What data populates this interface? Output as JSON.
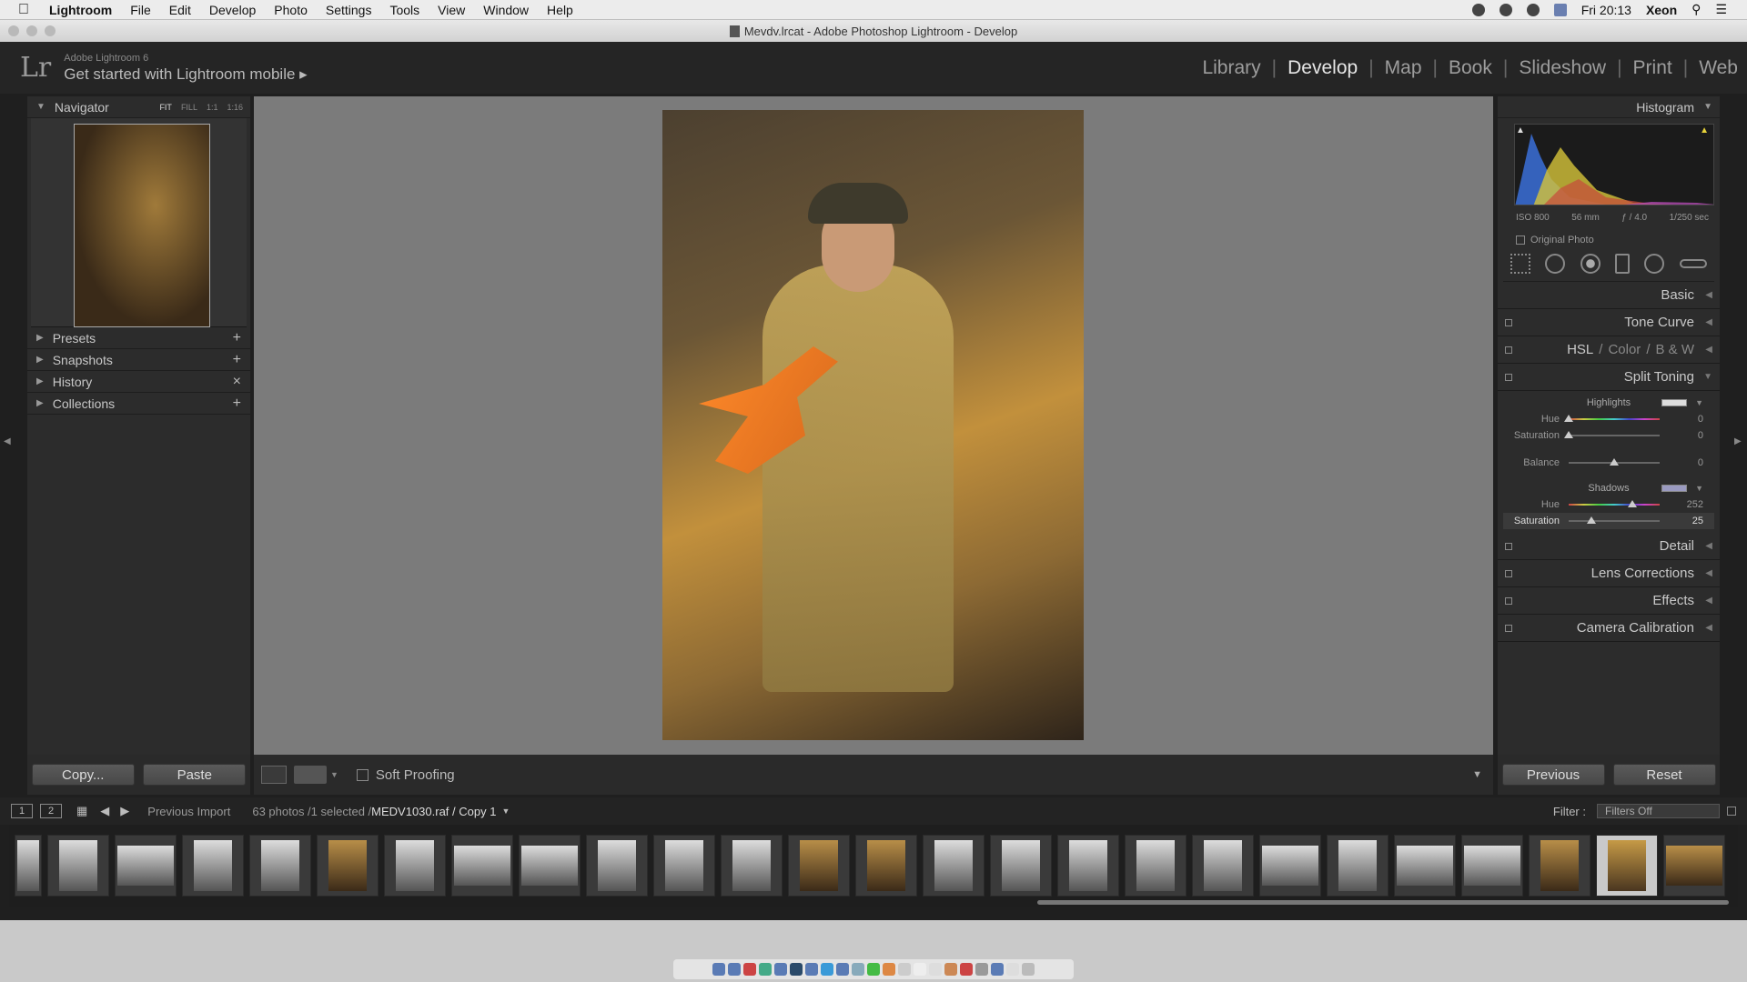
{
  "menubar": {
    "app": "Lightroom",
    "items": [
      "File",
      "Edit",
      "Develop",
      "Photo",
      "Settings",
      "Tools",
      "View",
      "Window",
      "Help"
    ],
    "clock": "Fri 20:13",
    "user": "Xeon"
  },
  "window": {
    "title": "Mevdv.lrcat - Adobe Photoshop Lightroom - Develop"
  },
  "identity": {
    "product": "Adobe Lightroom 6",
    "mobile": "Get started with Lightroom mobile"
  },
  "modules": {
    "items": [
      "Library",
      "Develop",
      "Map",
      "Book",
      "Slideshow",
      "Print",
      "Web"
    ],
    "active": "Develop"
  },
  "left_panel": {
    "navigator": "Navigator",
    "nav_options": [
      "FIT",
      "FILL",
      "1:1",
      "1:16"
    ],
    "presets": "Presets",
    "snapshots": "Snapshots",
    "history": "History",
    "collections": "Collections",
    "copy_btn": "Copy...",
    "paste_btn": "Paste"
  },
  "toolbar": {
    "soft_proofing": "Soft Proofing"
  },
  "right_panel": {
    "histogram": "Histogram",
    "iso": "ISO 800",
    "focal": "56 mm",
    "aperture": "ƒ / 4.0",
    "shutter": "1/250 sec",
    "original_photo": "Original Photo",
    "sections": {
      "basic": "Basic",
      "tone_curve": "Tone Curve",
      "hsl": "HSL",
      "color": "Color",
      "bw": "B & W",
      "split_toning": "Split Toning",
      "detail": "Detail",
      "lens": "Lens Corrections",
      "effects": "Effects",
      "calibration": "Camera Calibration"
    },
    "split": {
      "highlights": "Highlights",
      "shadows": "Shadows",
      "hue_label": "Hue",
      "sat_label": "Saturation",
      "balance_label": "Balance",
      "h_hue": "0",
      "h_sat": "0",
      "balance": "0",
      "s_hue": "252",
      "s_sat": "25"
    },
    "previous_btn": "Previous",
    "reset_btn": "Reset"
  },
  "filmbar": {
    "page1": "1",
    "page2": "2",
    "source": "Previous Import",
    "count": "63 photos /1 selected /",
    "file": "MEDV1030.raf / Copy 1",
    "filter_label": "Filter :",
    "filter_value": "Filters Off"
  }
}
